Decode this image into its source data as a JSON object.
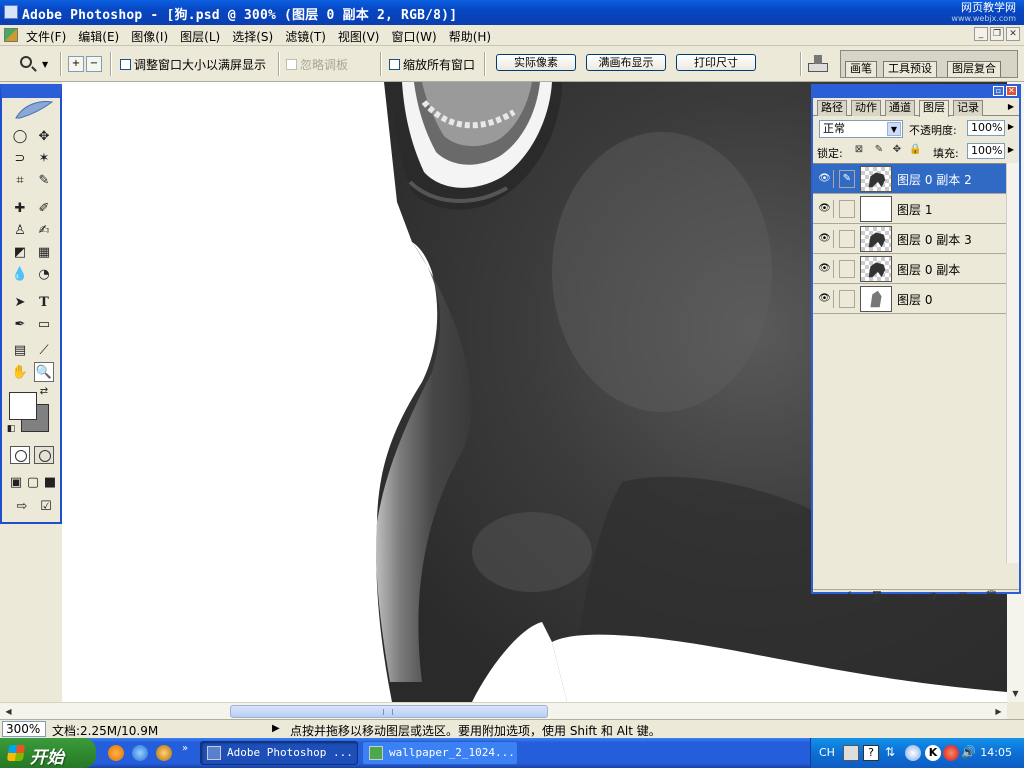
{
  "window": {
    "title": "Adobe Photoshop - [狗.psd @ 300% (图层 0 副本 2, RGB/8)]",
    "watermark": "网页教学网",
    "watermark_sub": "www.webjx.com"
  },
  "menu": [
    "文件(F)",
    "编辑(E)",
    "图像(I)",
    "图层(L)",
    "选择(S)",
    "滤镜(T)",
    "视图(V)",
    "窗口(W)",
    "帮助(H)"
  ],
  "options": {
    "resize_windows": "调整窗口大小以满屏显示",
    "ignore_palettes": "忽略调板",
    "zoom_all": "缩放所有窗口",
    "actual_pixels": "实际像素",
    "fit_screen": "满画布显示",
    "print_size": "打印尺寸"
  },
  "palette_well": [
    "画笔",
    "工具预设",
    "图层复合"
  ],
  "layers_palette": {
    "tabs": [
      "路径",
      "动作",
      "通道",
      "图层",
      "记录"
    ],
    "active_tab": "图层",
    "blend_mode": "正常",
    "opacity_label": "不透明度:",
    "opacity": "100%",
    "lock_label": "锁定:",
    "fill_label": "填充:",
    "fill": "100%",
    "layers": [
      {
        "name": "图层 0 副本 2",
        "selected": true,
        "thumb": "dog"
      },
      {
        "name": "图层 1",
        "selected": false,
        "thumb": "white"
      },
      {
        "name": "图层 0 副本 3",
        "selected": false,
        "thumb": "dog"
      },
      {
        "name": "图层 0 副本",
        "selected": false,
        "thumb": "dog"
      },
      {
        "name": "图层 0",
        "selected": false,
        "thumb": "dog-gray"
      }
    ]
  },
  "status": {
    "zoom": "300%",
    "doc_info": "文档:2.25M/10.9M",
    "tip": "点按并拖移以移动图层或选区。要用附加选项，使用 Shift 和 Alt 键。"
  },
  "taskbar": {
    "start": "开始",
    "windows": [
      {
        "label": "Adobe Photoshop ...",
        "active": true
      },
      {
        "label": "wallpaper_2_1024...",
        "active": false
      }
    ],
    "lang": "CH",
    "clock": "14:05"
  },
  "colors": {
    "selection": "#316ac5",
    "xp_blue": "#245edb",
    "foreground_swatch": "#ffffff",
    "background_swatch": "#808080"
  }
}
